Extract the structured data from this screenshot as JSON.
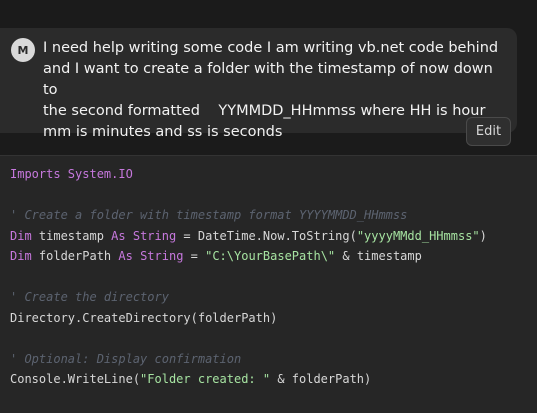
{
  "message": {
    "avatar_initial": "M",
    "text": "I need help writing some code I am writing vb.net code behind\nand I want to create a folder with the timestamp of now down to\nthe second formatted    YYMMDD_HHmmss where HH is hour\nmm is minutes and ss is seconds",
    "edit_label": "Edit"
  },
  "code": {
    "l1_kw": "Imports",
    "l1_rest": " System.IO",
    "l3_comment": "' Create a folder with timestamp format YYYYMMDD_HHmmss",
    "l4_dim": "Dim",
    "l4_var": " timestamp ",
    "l4_as": "As",
    "l4_type": " String",
    "l4_mid": " = DateTime.Now.ToString(",
    "l4_str": "\"yyyyMMdd_HHmmss\"",
    "l4_end": ")",
    "l5_dim": "Dim",
    "l5_var": " folderPath ",
    "l5_as": "As",
    "l5_type": " String",
    "l5_mid": " = ",
    "l5_str": "\"C:\\YourBasePath\\\"",
    "l5_end": " & timestamp",
    "l7_comment": "' Create the directory",
    "l8": "Directory.CreateDirectory(folderPath)",
    "l10_comment": "' Optional: Display confirmation",
    "l11_start": "Console.WriteLine(",
    "l11_str": "\"Folder created: \"",
    "l11_end": " & folderPath)"
  }
}
